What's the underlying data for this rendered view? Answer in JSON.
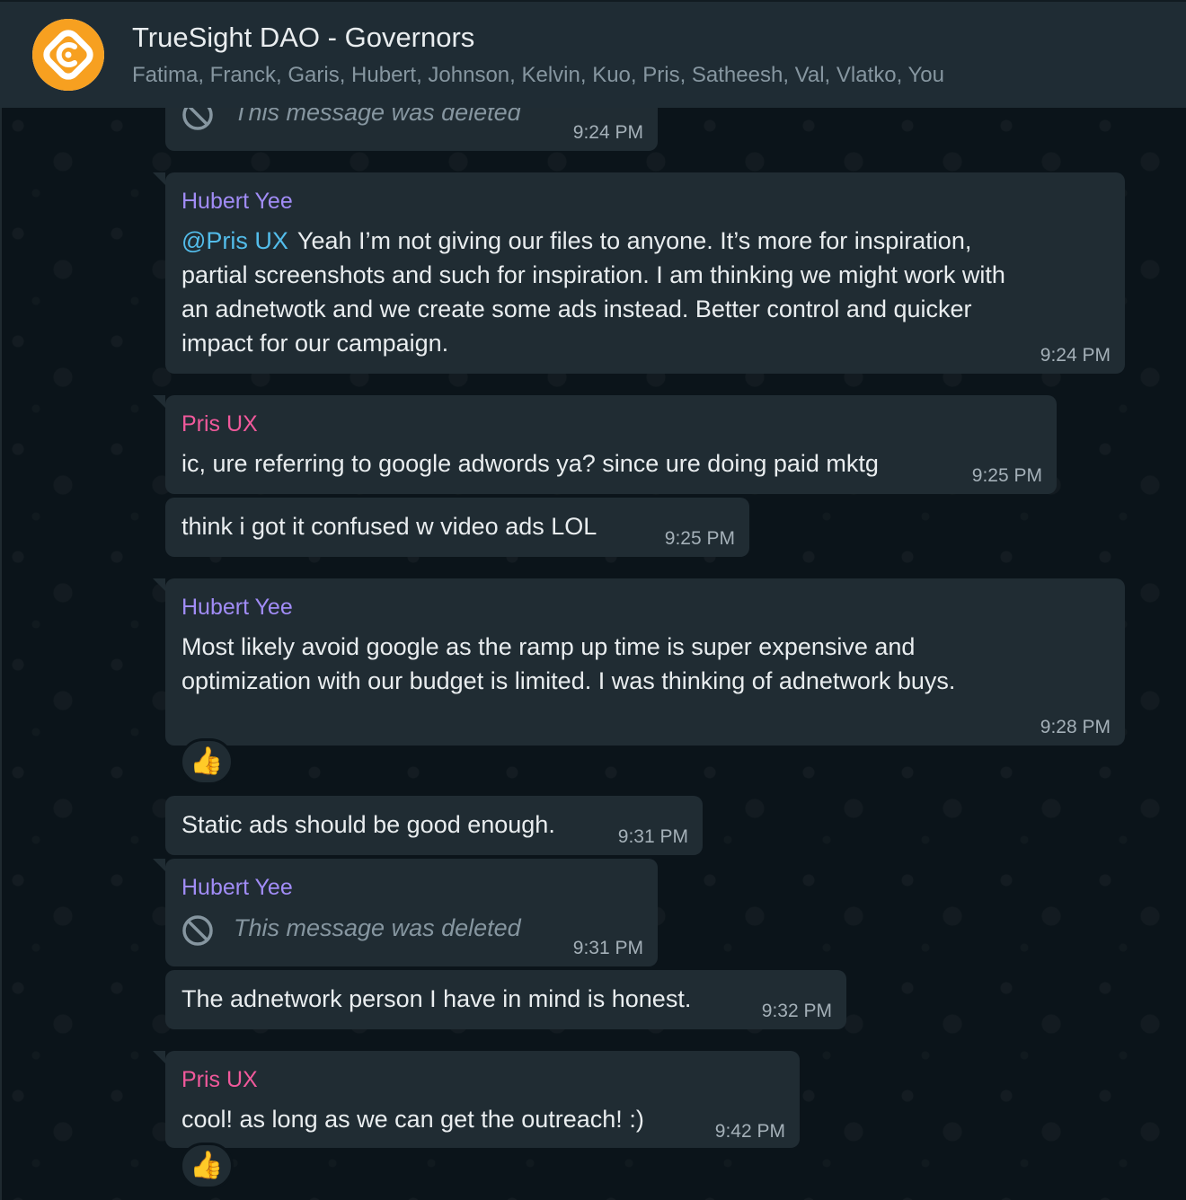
{
  "header": {
    "title": "TrueSight DAO - Governors",
    "members": "Fatima, Franck, Garis, Hubert, Johnson, Kelvin, Kuo, Pris, Satheesh, Val, Vlatko, You",
    "avatar_icon": "truesight-logo-icon",
    "avatar_color": "#f7a020"
  },
  "messages": [
    {
      "deleted_text": "This message was deleted",
      "time": "9:24 PM"
    },
    {
      "sender": "Hubert Yee",
      "mention": "@Pris UX",
      "lines": [
        "Yeah I’m not giving our files to anyone. It’s more for inspiration,",
        "partial screenshots and such for inspiration. I am thinking we might work with",
        "an adnetwotk and we create some ads instead. Better control and quicker",
        "impact for our campaign."
      ],
      "time": "9:24 PM"
    },
    {
      "sender": "Pris UX",
      "text": "ic, ure referring to google adwords ya? since ure doing paid mktg",
      "time": "9:25 PM"
    },
    {
      "text": "think i got it confused w video ads LOL",
      "time": "9:25 PM"
    },
    {
      "sender": "Hubert Yee",
      "lines": [
        "Most likely avoid google as the ramp up time is super expensive and",
        "optimization with our budget is limited. I was thinking of adnetwork buys."
      ],
      "time": "9:28 PM",
      "reaction": "👍"
    },
    {
      "text": "Static ads should be good enough.",
      "time": "9:31 PM"
    },
    {
      "sender": "Hubert Yee",
      "deleted_text": "This message was deleted",
      "time": "9:31 PM"
    },
    {
      "text": "The adnetwork person I have in mind is honest.",
      "time": "9:32 PM"
    },
    {
      "sender": "Pris UX",
      "text": "cool! as long as we can get the outreach! :)",
      "time": "9:42 PM",
      "reaction": "👍"
    }
  ],
  "colors": {
    "background": "#0b141a",
    "header": "#1f2c34",
    "bubble": "#202c33",
    "sender_hubert": "#a18cf6",
    "sender_pris": "#f0599b",
    "mention": "#53bdeb"
  }
}
